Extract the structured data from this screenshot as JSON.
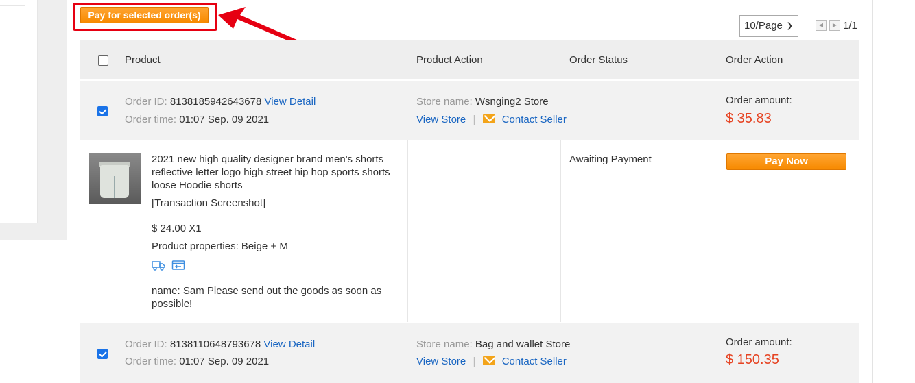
{
  "toolbar": {
    "pay_selected_label": "Pay for selected order(s)"
  },
  "pagination": {
    "per_page": "10/Page",
    "page_count": "1/1"
  },
  "table_header": {
    "product": "Product",
    "product_action": "Product Action",
    "order_status": "Order Status",
    "order_action": "Order Action"
  },
  "orders": [
    {
      "order_id_label": "Order ID:",
      "order_id": "8138185942643678",
      "view_detail": "View Detail",
      "order_time_label": "Order time:",
      "order_time": "01:07 Sep. 09 2021",
      "store_name_label": "Store name:",
      "store_name": "Wsnging2 Store",
      "view_store": "View Store",
      "separator": "|",
      "contact_seller": "Contact Seller",
      "amount_label": "Order amount:",
      "amount": "$ 35.83",
      "checked": true,
      "product": {
        "title": "2021 new high quality designer brand men's shorts reflective letter logo high street hip hop sports shorts loose Hoodie shorts",
        "screenshot_link": "[Transaction Screenshot]",
        "price": "$ 24.00 X1",
        "properties": "Product properties: Beige + M",
        "note": "name: Sam Please send out the goods as soon as possible!",
        "icons": [
          "truck-icon",
          "return-icon"
        ]
      },
      "status": "Awaiting Payment",
      "pay_now": "Pay Now"
    },
    {
      "order_id_label": "Order ID:",
      "order_id": "8138110648793678",
      "view_detail": "View Detail",
      "order_time_label": "Order time:",
      "order_time": "01:07 Sep. 09 2021",
      "store_name_label": "Store name:",
      "store_name": "Bag and wallet Store",
      "view_store": "View Store",
      "separator": "|",
      "contact_seller": "Contact Seller",
      "amount_label": "Order amount:",
      "amount": "$ 150.35",
      "checked": true
    }
  ],
  "colors": {
    "accent_orange": "#f78a00",
    "annotation_red": "#e60012",
    "link_blue": "#1a66c2",
    "price_red": "#e64322"
  }
}
